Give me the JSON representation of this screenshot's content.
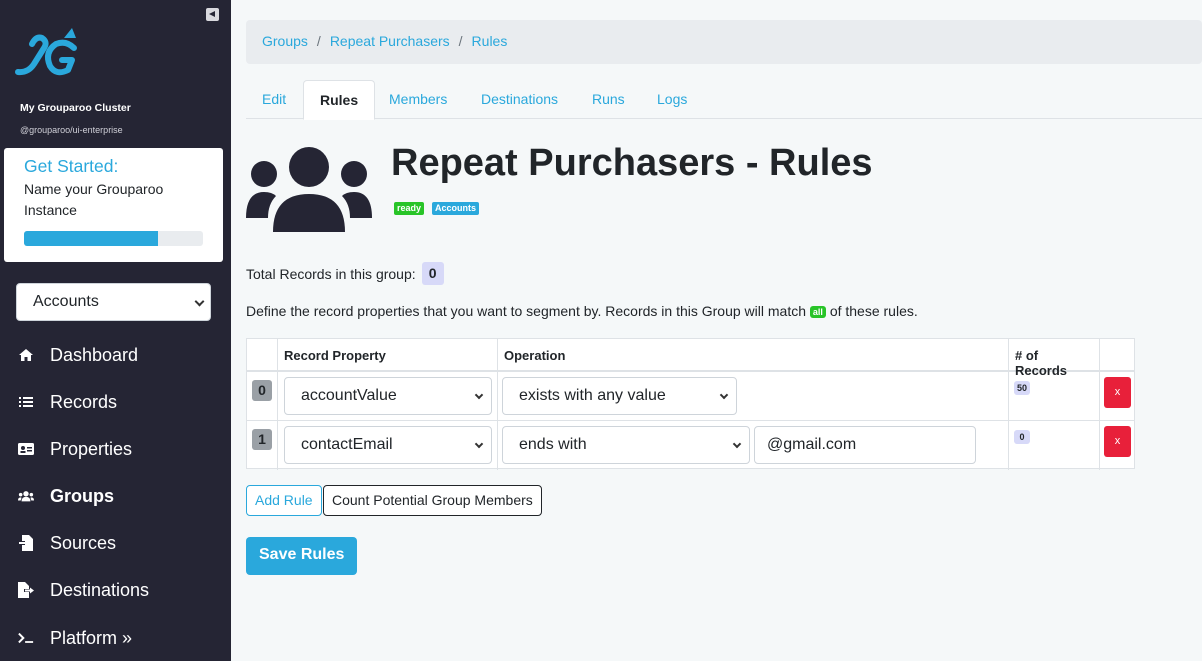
{
  "sidebar": {
    "cluster_name": "My Grouparoo Cluster",
    "cluster_sub": "@grouparoo/ui-enterprise",
    "get_started": {
      "title": "Get Started:",
      "text": "Name your Grouparoo Instance",
      "progress": 0.75
    },
    "model_select": "Accounts",
    "items": [
      {
        "label": "Dashboard",
        "icon": "home-icon"
      },
      {
        "label": "Records",
        "icon": "list-icon"
      },
      {
        "label": "Properties",
        "icon": "id-card-icon"
      },
      {
        "label": "Groups",
        "icon": "users-icon"
      },
      {
        "label": "Sources",
        "icon": "file-import-icon"
      },
      {
        "label": "Destinations",
        "icon": "file-export-icon"
      },
      {
        "label": "Platform »",
        "icon": "terminal-icon"
      }
    ]
  },
  "breadcrumb": [
    "Groups",
    "Repeat Purchasers",
    "Rules"
  ],
  "tabs": [
    "Edit",
    "Rules",
    "Members",
    "Destinations",
    "Runs",
    "Logs"
  ],
  "page": {
    "title": "Repeat Purchasers - Rules",
    "state_badge": "ready",
    "model_badge": "Accounts",
    "total_label": "Total Records in this group:",
    "total_count": "0",
    "define_before": "Define the record properties that you want to segment by. Records in this Group will match",
    "define_match": "all",
    "define_after": "of these rules."
  },
  "table": {
    "headers": [
      "Record Property",
      "Operation",
      "# of Records"
    ],
    "rows": [
      {
        "index": "0",
        "property": "accountValue",
        "operation": "exists with any value",
        "value": "",
        "count": "50",
        "delete": "x"
      },
      {
        "index": "1",
        "property": "contactEmail",
        "operation": "ends with",
        "value": "@gmail.com",
        "count": "0",
        "delete": "x"
      }
    ]
  },
  "buttons": {
    "add_rule": "Add Rule",
    "count_members": "Count Potential Group Members",
    "save": "Save Rules"
  },
  "colors": {
    "primary": "#2aa8dc",
    "sidebar_bg": "#252534",
    "success": "#28c428",
    "danger": "#e8203a"
  }
}
